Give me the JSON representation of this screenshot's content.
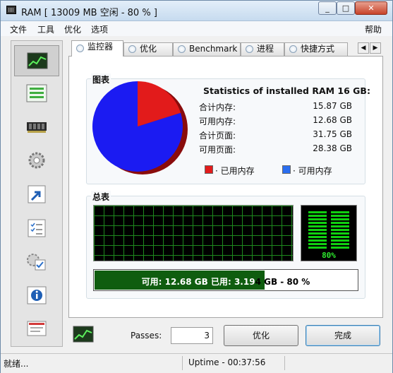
{
  "window": {
    "title": "RAM [ 13009 MB 空闲 - 80 % ]",
    "min": "_",
    "max": "□",
    "close": "✕"
  },
  "menu": {
    "file": "文件",
    "tools": "工具",
    "optimize": "优化",
    "options": "选项",
    "help": "帮助"
  },
  "sidebar": {
    "icons": [
      "monitor-chart-icon",
      "list-icon",
      "memory-chip-icon",
      "gear-icon",
      "shortcut-arrow-icon",
      "checklist-icon",
      "settings-check-icon",
      "info-icon",
      "letter-icon"
    ]
  },
  "tabs": [
    "监控器",
    "优化",
    "Benchmark",
    "进程",
    "快捷方式"
  ],
  "chart": {
    "group_title": "图表",
    "stats_title": "Statistics of installed RAM 16 GB:",
    "stats": [
      {
        "label": "合计内存:",
        "value": "15.87 GB"
      },
      {
        "label": "可用内存:",
        "value": "12.68 GB"
      },
      {
        "label": "合计页面:",
        "value": "31.75 GB"
      },
      {
        "label": "可用页面:",
        "value": "28.38 GB"
      }
    ],
    "legend_used": "· 已用内存",
    "legend_free": "· 可用内存",
    "used_color": "#e21b1b",
    "free_color": "#1b1bf2"
  },
  "chart_data": {
    "type": "pie",
    "categories": [
      "已用内存",
      "可用内存"
    ],
    "values": [
      3.194,
      12.68
    ],
    "title": "",
    "colors": [
      "#e21b1b",
      "#1b1bf2"
    ]
  },
  "summary": {
    "group_title": "总表",
    "meter_percent": "80%",
    "bar_text_free": "可用: 12.68 GB",
    "bar_text_used_label": "已用: 3.19",
    "bar_text_used_rest": "4 GB - 80 %",
    "bar_fill_fraction": 0.645
  },
  "bottom": {
    "passes_label": "Passes:",
    "passes_value": "3",
    "optimize_button": "优化",
    "done_button": "完成"
  },
  "status": {
    "left": "就绪...",
    "uptime": "Uptime - 00:37:56"
  }
}
